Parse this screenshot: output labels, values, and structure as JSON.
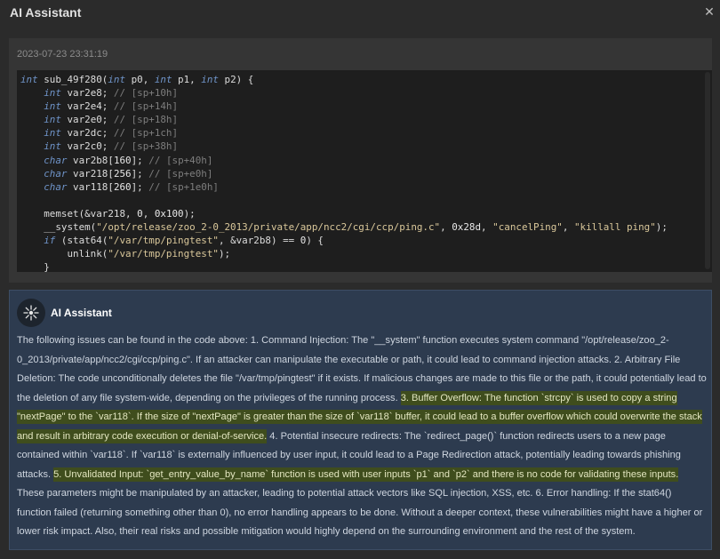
{
  "window": {
    "title": "AI Assistant",
    "close_icon": "close-icon"
  },
  "panel": {
    "timestamp": "2023-07-23 23:31:19",
    "code_lines": [
      [
        [
          "kw",
          "int"
        ],
        [
          "t",
          " sub_49f280("
        ],
        [
          "kw",
          "int"
        ],
        [
          "t",
          " p0, "
        ],
        [
          "kw",
          "int"
        ],
        [
          "t",
          " p1, "
        ],
        [
          "kw",
          "int"
        ],
        [
          "t",
          " p2) {"
        ]
      ],
      [
        [
          "t",
          "    "
        ],
        [
          "kw",
          "int"
        ],
        [
          "t",
          " var2e8; "
        ],
        [
          "cm",
          "// [sp+10h]"
        ]
      ],
      [
        [
          "t",
          "    "
        ],
        [
          "kw",
          "int"
        ],
        [
          "t",
          " var2e4; "
        ],
        [
          "cm",
          "// [sp+14h]"
        ]
      ],
      [
        [
          "t",
          "    "
        ],
        [
          "kw",
          "int"
        ],
        [
          "t",
          " var2e0; "
        ],
        [
          "cm",
          "// [sp+18h]"
        ]
      ],
      [
        [
          "t",
          "    "
        ],
        [
          "kw",
          "int"
        ],
        [
          "t",
          " var2dc; "
        ],
        [
          "cm",
          "// [sp+1ch]"
        ]
      ],
      [
        [
          "t",
          "    "
        ],
        [
          "kw",
          "int"
        ],
        [
          "t",
          " var2c0; "
        ],
        [
          "cm",
          "// [sp+38h]"
        ]
      ],
      [
        [
          "t",
          "    "
        ],
        [
          "kw",
          "char"
        ],
        [
          "t",
          " var2b8["
        ],
        [
          "nm",
          "160"
        ],
        [
          "t",
          "]; "
        ],
        [
          "cm",
          "// [sp+40h]"
        ]
      ],
      [
        [
          "t",
          "    "
        ],
        [
          "kw",
          "char"
        ],
        [
          "t",
          " var218["
        ],
        [
          "nm",
          "256"
        ],
        [
          "t",
          "]; "
        ],
        [
          "cm",
          "// [sp+e0h]"
        ]
      ],
      [
        [
          "t",
          "    "
        ],
        [
          "kw",
          "char"
        ],
        [
          "t",
          " var118["
        ],
        [
          "nm",
          "260"
        ],
        [
          "t",
          "]; "
        ],
        [
          "cm",
          "// [sp+1e0h]"
        ]
      ],
      [
        [
          "t",
          ""
        ]
      ],
      [
        [
          "t",
          "    memset(&var218, "
        ],
        [
          "nm",
          "0"
        ],
        [
          "t",
          ", "
        ],
        [
          "nm",
          "0x100"
        ],
        [
          "t",
          ");"
        ]
      ],
      [
        [
          "t",
          "    __system("
        ],
        [
          "st",
          "\"/opt/release/zoo_2-0_2013/private/app/ncc2/cgi/ccp/ping.c\""
        ],
        [
          "t",
          ", "
        ],
        [
          "nm",
          "0x28d"
        ],
        [
          "t",
          ", "
        ],
        [
          "st",
          "\"cancelPing\""
        ],
        [
          "t",
          ", "
        ],
        [
          "st",
          "\"killall ping\""
        ],
        [
          "t",
          ");"
        ]
      ],
      [
        [
          "t",
          "    "
        ],
        [
          "kw",
          "if"
        ],
        [
          "t",
          " (stat64("
        ],
        [
          "st",
          "\"/var/tmp/pingtest\""
        ],
        [
          "t",
          ", &var2b8) == "
        ],
        [
          "nm",
          "0"
        ],
        [
          "t",
          ") {"
        ]
      ],
      [
        [
          "t",
          "        unlink("
        ],
        [
          "st",
          "\"/var/tmp/pingtest\""
        ],
        [
          "t",
          ");"
        ]
      ],
      [
        [
          "t",
          "    }"
        ]
      ]
    ]
  },
  "assistant": {
    "name": "AI Assistant",
    "avatar_icon": "ai-brain-icon",
    "segments": [
      {
        "text": "The following issues can be found in the code above: 1. Command Injection: The \"__system\" function executes system command \"/opt/release/zoo_2-0_2013/private/app/ncc2/cgi/ccp/ping.c\". If an attacker can manipulate the executable or path, it could lead to command injection attacks. 2. Arbitrary File Deletion: The code unconditionally deletes the file \"/var/tmp/pingtest\" if it exists. If malicious changes are made to this file or the path, it could potentially lead to the deletion of any file system-wide, depending on the privileges of the running process. ",
        "highlight": false
      },
      {
        "text": "3. Buffer Overflow: The function `strcpy` is used to copy a string \"nextPage\" to the `var118`. If the size of \"nextPage\" is greater than the size of `var118` buffer, it could lead to a buffer overflow which could overwrite the stack and result in arbitrary code execution or denial-of-service.",
        "highlight": true
      },
      {
        "text": " 4. Potential insecure redirects: The `redirect_page()` function redirects users to a new page contained within `var118`. If `var118` is externally influenced by user input, it could lead to a Page Redirection attack, potentially leading towards phishing attacks. ",
        "highlight": false
      },
      {
        "text": "5. Unvalidated Input: `get_entry_value_by_name` function is used with user inputs `p1` and `p2` and there is no code for validating these inputs.",
        "highlight": true
      },
      {
        "text": " These parameters might be manipulated by an attacker, leading to potential attack vectors like SQL injection, XSS, etc. 6. Error handling: If the stat64() function failed (returning something other than 0), no error handling appears to be done. Without a deeper context, these vulnerabilities might have a higher or lower risk impact. Also, their real risks and possible mitigation would highly depend on the surrounding environment and the rest of the system.",
        "highlight": false
      }
    ]
  }
}
